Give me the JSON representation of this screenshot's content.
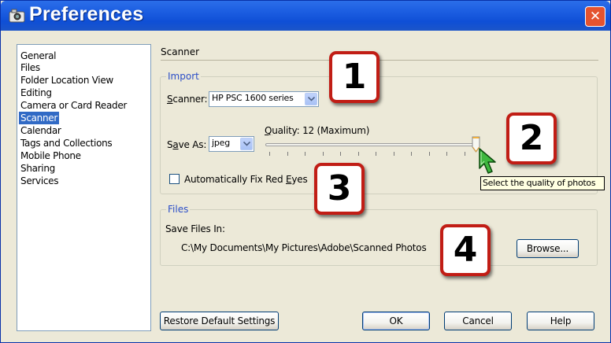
{
  "window": {
    "title": "Preferences",
    "close_label": "✕"
  },
  "sidebar": {
    "items": [
      {
        "label": "General"
      },
      {
        "label": "Files"
      },
      {
        "label": "Folder Location View"
      },
      {
        "label": "Editing"
      },
      {
        "label": "Camera or Card Reader"
      },
      {
        "label": "Scanner",
        "selected": true
      },
      {
        "label": "Calendar"
      },
      {
        "label": "Tags and Collections"
      },
      {
        "label": "Mobile Phone"
      },
      {
        "label": "Sharing"
      },
      {
        "label": "Services"
      }
    ]
  },
  "panel": {
    "title": "Scanner",
    "import": {
      "group_label": "Import",
      "scanner_label_accel": "S",
      "scanner_label_rest": "canner:",
      "scanner_value": "HP PSC 1600 series",
      "save_as_label_pre": "S",
      "save_as_label_accel": "a",
      "save_as_label_rest": "ve As:",
      "save_as_value": "jpeg",
      "quality_label_accel": "Q",
      "quality_label_rest": "uality: 12 (Maximum)",
      "quality_value": 12,
      "quality_max": 12,
      "quality_min": 1,
      "auto_fix_label_pre": "Automatically Fix Red ",
      "auto_fix_label_accel": "E",
      "auto_fix_label_rest": "yes",
      "auto_fix_checked": false
    },
    "files": {
      "group_label": "Files",
      "save_in_label": "Save Files In:",
      "save_in_path": "C:\\My Documents\\My Pictures\\Adobe\\Scanned Photos",
      "browse_label": "Browse..."
    }
  },
  "tooltip": {
    "text": "Select the quality of photos"
  },
  "footer": {
    "restore_label": "Restore Default Settings",
    "ok_label": "OK",
    "cancel_label": "Cancel",
    "help_label": "Help"
  },
  "callouts": [
    "1",
    "2",
    "3",
    "4"
  ],
  "colors": {
    "title_bar": "#1a5ce0",
    "selection": "#316ac5",
    "callout_border": "#c11d15",
    "group_label": "#2c4fc8",
    "close_button": "#e4532f"
  },
  "icons": {
    "title": "camera-icon",
    "close": "close-icon",
    "dropdown": "chevron-down-icon",
    "cursor": "mouse-pointer-icon"
  }
}
